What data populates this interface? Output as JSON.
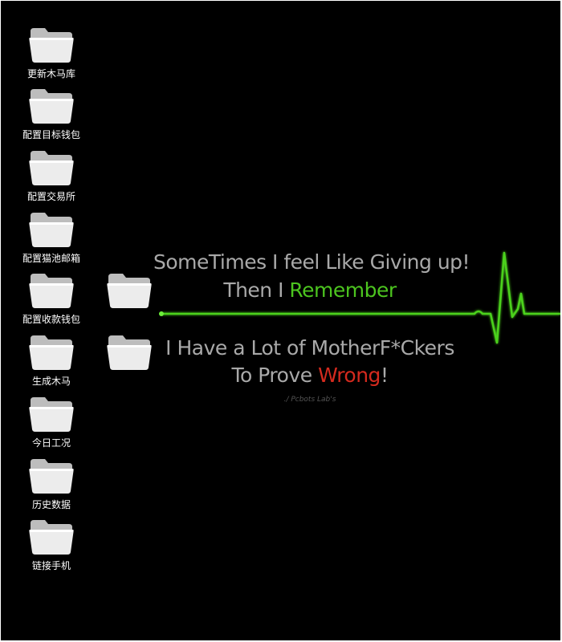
{
  "desktop": {
    "icons": [
      {
        "label": "更新木马库"
      },
      {
        "label": "配置目标钱包"
      },
      {
        "label": "配置交易所"
      },
      {
        "label": "配置猫池邮箱"
      },
      {
        "label": "配置收款钱包"
      },
      {
        "label": "生成木马"
      },
      {
        "label": "今日工况"
      },
      {
        "label": "历史数据"
      },
      {
        "label": "链接手机"
      },
      {
        "label": ""
      },
      {
        "label": ""
      }
    ]
  },
  "wallpaper": {
    "line1": "SomeTimes I feel Like Giving up!",
    "line2_prefix": "Then I ",
    "line2_highlight": "Remember",
    "line3": "I Have a Lot of MotherF*Ckers",
    "line4_prefix": "To Prove ",
    "line4_highlight": "Wrong",
    "line4_suffix": "!",
    "signature": "./ Pcbots Lab's",
    "colors": {
      "background": "#000000",
      "text": "#a9a9a9",
      "accent_green": "#4cc41f",
      "accent_red": "#d42a1e"
    }
  }
}
